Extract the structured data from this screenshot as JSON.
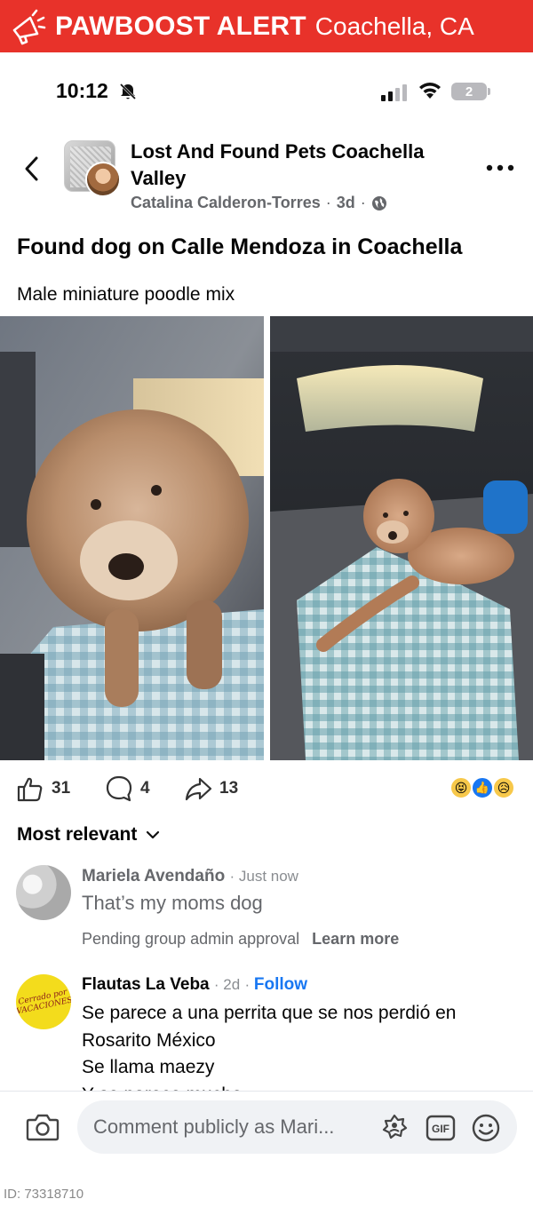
{
  "banner": {
    "brand": "PAWBOOST ALERT",
    "location": "Coachella, CA",
    "icon": "megaphone-icon",
    "color": "#e8322a"
  },
  "status_bar": {
    "time": "10:12",
    "battery": "2"
  },
  "post": {
    "group_name": "Lost And Found Pets Coachella Valley",
    "author": "Catalina Calderon-Torres",
    "age": "3d",
    "title": "Found dog on Calle Mendoza in Coachella",
    "body": "Male miniature poodle mix",
    "likes": "31",
    "comments": "4",
    "shares": "13"
  },
  "sort_label": "Most relevant",
  "comments": [
    {
      "name": "Mariela Avendaño",
      "time": "Just now",
      "text": "That’s my moms dog",
      "pending": "Pending group admin approval",
      "learn_more": "Learn more"
    },
    {
      "name": "Flautas La Veba",
      "time": "2d",
      "follow": "Follow",
      "avatar_text": "Cerrado por VACACIONES",
      "lines": [
        "Se parece a una perrita que se nos perdió en",
        "Rosarito México",
        "Se llama maezy",
        "Y se parece mucho"
      ]
    }
  ],
  "composer": {
    "placeholder": "Comment publicly as Mari..."
  },
  "footer": {
    "id": "ID: 73318710"
  }
}
